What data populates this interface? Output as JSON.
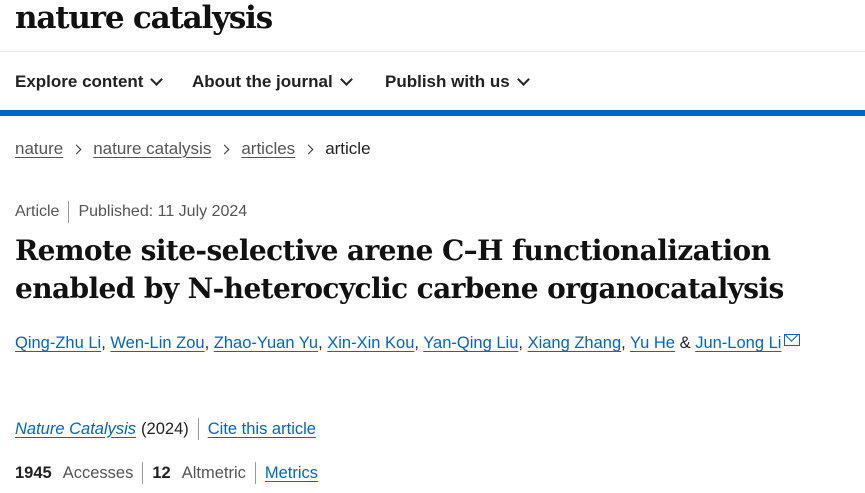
{
  "header": {
    "logo": "nature catalysis"
  },
  "nav": {
    "items": [
      {
        "label": "Explore content"
      },
      {
        "label": "About the journal"
      },
      {
        "label": "Publish with us"
      }
    ]
  },
  "breadcrumb": {
    "items": [
      "nature",
      "nature catalysis",
      "articles"
    ],
    "current": "article"
  },
  "article": {
    "type": "Article",
    "published": "Published: 11 July 2024",
    "title": "Remote site-selective arene C–H functionalization enabled by N-heterocyclic carbene organocatalysis",
    "authors": [
      "Qing-Zhu Li",
      "Wen-Lin Zou",
      "Zhao-Yuan Yu",
      "Xin-Xin Kou",
      "Yan-Qing Liu",
      "Xiang Zhang",
      "Yu He",
      "Jun-Long Li"
    ],
    "separator": ",",
    "ampersand": "&",
    "journal": "Nature Catalysis",
    "year": "(2024)",
    "cite_label": "Cite this article"
  },
  "metrics": {
    "accesses_count": "1945",
    "accesses_label": "Accesses",
    "altmetric_count": "12",
    "altmetric_label": "Altmetric",
    "metrics_link": "Metrics"
  },
  "colors": {
    "brand_blue": "#0067c5",
    "link": "#0067c5",
    "text": "#222222"
  }
}
